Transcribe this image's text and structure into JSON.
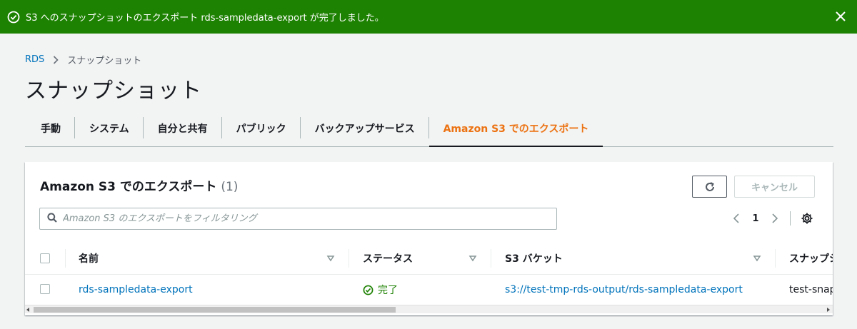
{
  "flash": {
    "message": "S3 へのスナップショットのエクスポート rds-sampledata-export が完了しました。",
    "color": "#1d8102"
  },
  "breadcrumb": {
    "root": "RDS",
    "current": "スナップショット"
  },
  "page_title": "スナップショット",
  "tabs": [
    {
      "label": "手動",
      "active": false
    },
    {
      "label": "システム",
      "active": false
    },
    {
      "label": "自分と共有",
      "active": false
    },
    {
      "label": "パブリック",
      "active": false
    },
    {
      "label": "バックアップサービス",
      "active": false
    },
    {
      "label": "Amazon S3 でのエクスポート",
      "active": true
    }
  ],
  "panel": {
    "title": "Amazon S3 でのエクスポート",
    "count": "(1)",
    "cancel_label": "キャンセル",
    "filter_placeholder": "Amazon S3 のエクスポートをフィルタリング",
    "page_number": "1"
  },
  "table": {
    "columns": [
      "名前",
      "ステータス",
      "S3 バケット",
      "スナップシ"
    ],
    "rows": [
      {
        "name": "rds-sampledata-export",
        "status": "完了",
        "bucket": "s3://test-tmp-rds-output/rds-sampledata-export",
        "snapshot": "test-snaps"
      }
    ]
  },
  "colors": {
    "accent": "#ec7211",
    "link": "#0073bb",
    "success": "#1d8102"
  }
}
